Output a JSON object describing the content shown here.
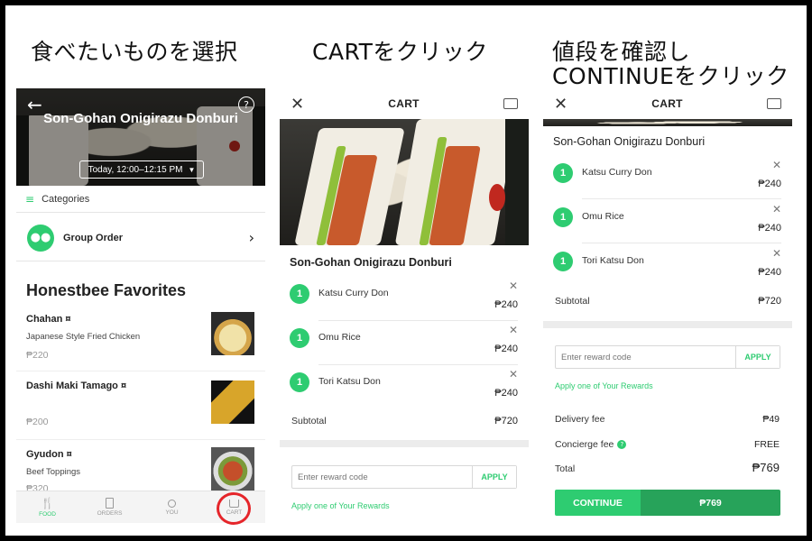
{
  "titles": {
    "step1": "食べたいものを選択",
    "step2": "CARTをクリック",
    "step3_line1": "値段を確認し",
    "step3_line2": "CONTINUEをクリック"
  },
  "panel1": {
    "store_name": "Son-Gohan Onigirazu Donburi",
    "time_slot": "Today, 12:00–12:15 PM",
    "categories_label": "Categories",
    "group_order_label": "Group Order",
    "section_title": "Honestbee Favorites",
    "products": [
      {
        "name": "Chahan",
        "badge": "¤",
        "desc": "Japanese Style Fried Chicken",
        "price": "₱220"
      },
      {
        "name": "Dashi Maki Tamago",
        "badge": "¤",
        "desc": "",
        "price": "₱200"
      },
      {
        "name": "Gyudon",
        "badge": "¤",
        "desc": "Beef Toppings",
        "price": "₱320"
      }
    ],
    "nav": [
      {
        "label": "FOOD",
        "icon": "food-icon",
        "active": true
      },
      {
        "label": "ORDERS",
        "icon": "orders-icon",
        "active": false
      },
      {
        "label": "YOU",
        "icon": "user-icon",
        "active": false
      },
      {
        "label": "CART",
        "icon": "cart-icon",
        "active": false
      }
    ],
    "colors": {
      "accent": "#2ecc71",
      "highlight": "#e5252a"
    }
  },
  "panel2": {
    "header_title": "CART",
    "store_name": "Son-Gohan Onigirazu Donburi",
    "items": [
      {
        "qty": "1",
        "name": "Katsu Curry Don",
        "price": "₱240"
      },
      {
        "qty": "1",
        "name": "Omu Rice",
        "price": "₱240"
      },
      {
        "qty": "1",
        "name": "Tori Katsu Don",
        "price": "₱240"
      }
    ],
    "subtotal_label": "Subtotal",
    "subtotal_value": "₱720",
    "reward_placeholder": "Enter reward code",
    "apply_label": "APPLY",
    "rewards_link": "Apply one of Your Rewards"
  },
  "panel3": {
    "header_title": "CART",
    "store_name": "Son-Gohan Onigirazu Donburi",
    "items": [
      {
        "qty": "1",
        "name": "Katsu Curry Don",
        "price": "₱240"
      },
      {
        "qty": "1",
        "name": "Omu Rice",
        "price": "₱240"
      },
      {
        "qty": "1",
        "name": "Tori Katsu Don",
        "price": "₱240"
      }
    ],
    "subtotal_label": "Subtotal",
    "subtotal_value": "₱720",
    "reward_placeholder": "Enter reward code",
    "apply_label": "APPLY",
    "rewards_link": "Apply one of Your Rewards",
    "delivery_label": "Delivery fee",
    "delivery_value": "₱49",
    "concierge_label": "Concierge fee",
    "concierge_value": "FREE",
    "total_label": "Total",
    "total_value": "₱769",
    "continue_label": "CONTINUE",
    "continue_price": "₱769"
  }
}
